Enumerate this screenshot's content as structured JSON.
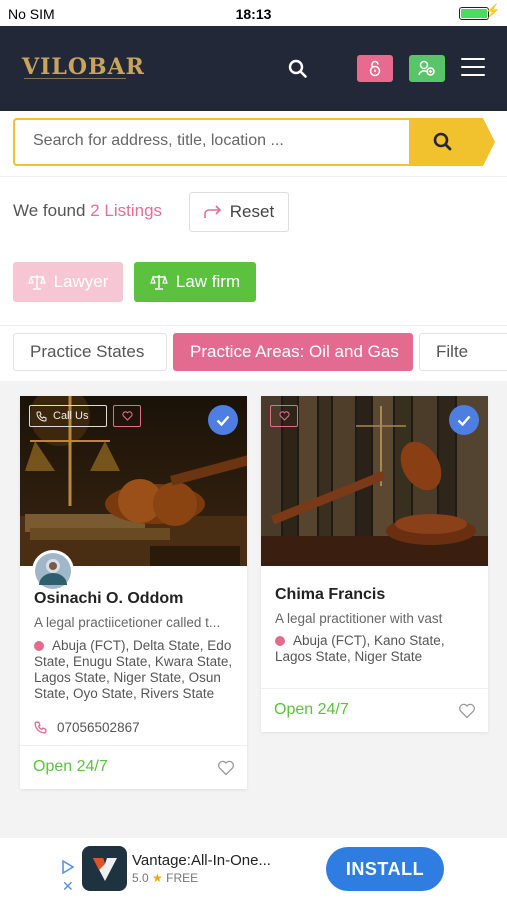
{
  "status": {
    "carrier": "No SIM",
    "time": "18:13",
    "battery_level": 1.0
  },
  "header": {
    "logo": "VILOBAR"
  },
  "search": {
    "placeholder": "Search for address, title, location ..."
  },
  "results": {
    "found_prefix": "We found",
    "found_count": "2 Listings",
    "reset_label": "Reset"
  },
  "categories": [
    {
      "label": "Lawyer",
      "icon": "scales-icon"
    },
    {
      "label": "Law firm",
      "icon": "scales-icon"
    }
  ],
  "filters": [
    {
      "label": "Practice States"
    },
    {
      "label": "Practice Areas: Oil and Gas"
    },
    {
      "label": "Filte"
    }
  ],
  "listings": [
    {
      "call_label": "Call Us",
      "name": "Osinachi O. Oddom",
      "description": "A legal practiicetioner called t...",
      "locations": "Abuja (FCT), Delta State, Edo State, Enugu State, Kwara State, Lagos State, Niger State, Osun State, Oyo State, Rivers State",
      "phone": "07056502867",
      "status": "Open 24/7"
    },
    {
      "name": "Chima Francis",
      "description": "A legal practitioner with vast",
      "locations": "Abuja (FCT), Kano State, Lagos State, Niger State",
      "status": "Open 24/7"
    }
  ],
  "ad": {
    "title": "Vantage:All-In-One...",
    "rating": "5.0",
    "price": "FREE",
    "install_label": "INSTALL"
  },
  "colors": {
    "header_bg": "#232838",
    "accent_pink": "#e46b90",
    "accent_green": "#5bc13e",
    "search_yellow": "#f2c12e",
    "verified_blue": "#4e7ee2"
  }
}
